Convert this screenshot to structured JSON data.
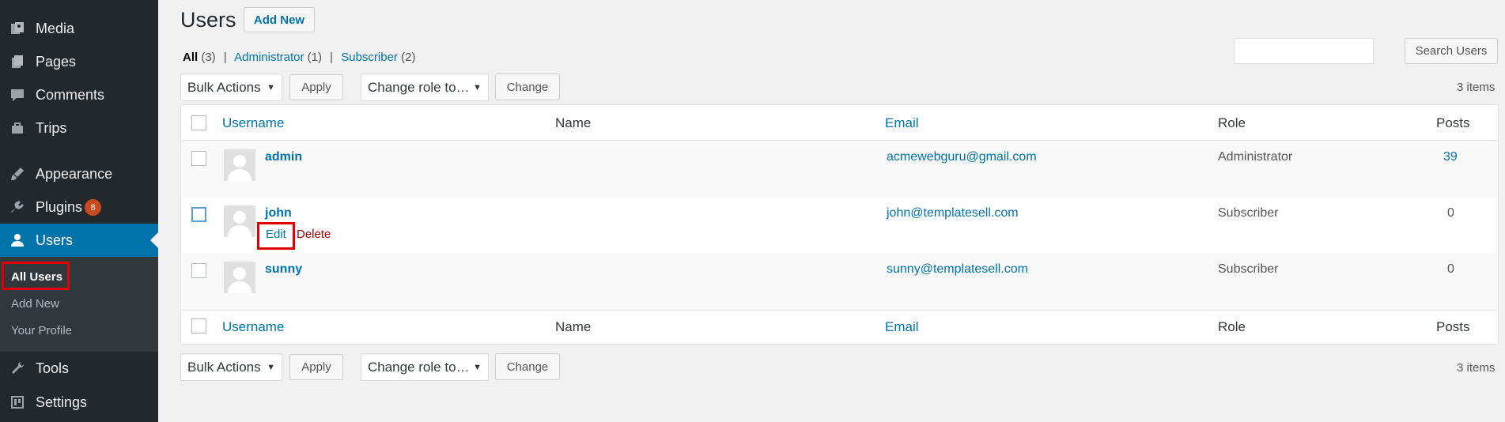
{
  "sidebar": {
    "items": [
      {
        "label": "Media",
        "icon": "media-icon"
      },
      {
        "label": "Pages",
        "icon": "pages-icon"
      },
      {
        "label": "Comments",
        "icon": "comments-icon"
      },
      {
        "label": "Trips",
        "icon": "trips-icon"
      },
      {
        "label": "Appearance",
        "icon": "appearance-icon"
      },
      {
        "label": "Plugins",
        "icon": "plugins-icon",
        "badge": "8"
      },
      {
        "label": "Users",
        "icon": "users-icon",
        "active": true
      },
      {
        "label": "Tools",
        "icon": "tools-icon"
      },
      {
        "label": "Settings",
        "icon": "settings-icon"
      }
    ],
    "submenu": [
      "All Users",
      "Add New",
      "Your Profile"
    ]
  },
  "header": {
    "title": "Users",
    "add_new": "Add New"
  },
  "filters": {
    "all": "All",
    "all_count": "(3)",
    "admin": "Administrator",
    "admin_count": "(1)",
    "subscriber": "Subscriber",
    "subscriber_count": "(2)",
    "separator": "|"
  },
  "search": {
    "button": "Search Users",
    "value": ""
  },
  "bulk": {
    "action_selected": "Bulk Actions",
    "apply": "Apply",
    "role_selected": "Change role to…",
    "change": "Change",
    "items_count": "3 items"
  },
  "table": {
    "columns": [
      "Username",
      "Name",
      "Email",
      "Role",
      "Posts"
    ],
    "rows": [
      {
        "username": "admin",
        "name": "",
        "email": "acmewebguru@gmail.com",
        "role": "Administrator",
        "posts": "39"
      },
      {
        "username": "john",
        "name": "",
        "email": "john@templatesell.com",
        "role": "Subscriber",
        "posts": "0",
        "actions": [
          "Edit",
          "Delete"
        ]
      },
      {
        "username": "sunny",
        "name": "",
        "email": "sunny@templatesell.com",
        "role": "Subscriber",
        "posts": "0"
      }
    ]
  },
  "colors": {
    "sidebar_bg": "#23282d",
    "active": "#0073aa",
    "link": "#0073aa",
    "delete": "#a00000",
    "highlight": "#e00000",
    "badge": "#ca4a1f"
  }
}
